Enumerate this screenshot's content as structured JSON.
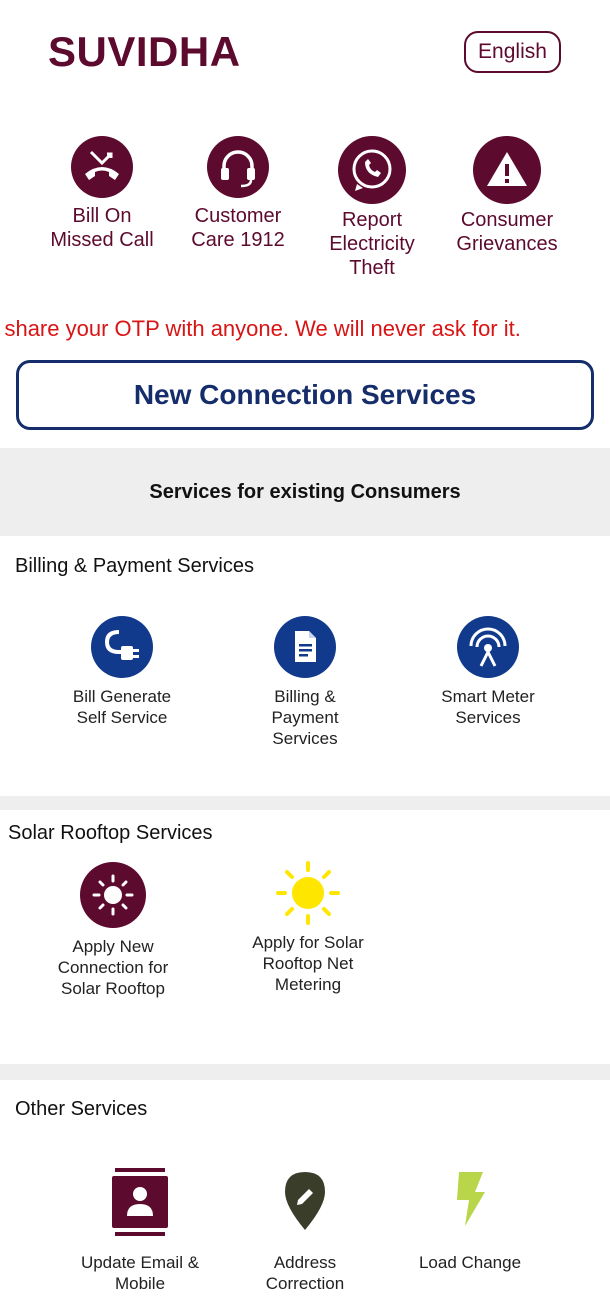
{
  "header": {
    "brand": "SUVIDHA",
    "language": "English"
  },
  "quick_actions": [
    {
      "label": "Bill On\nMissed Call",
      "icon": "phone-missed-icon"
    },
    {
      "label": "Customer\nCare 1912",
      "icon": "headset-icon"
    },
    {
      "label": "Report\nElectricity\nTheft",
      "icon": "whatsapp-icon"
    },
    {
      "label": "Consumer\nGrievances",
      "icon": "warning-icon"
    }
  ],
  "marquee_text": "ot share your OTP with anyone. We will never ask for it.",
  "new_connection_label": "New Connection Services",
  "existing_header": "Services for existing Consumers",
  "billing": {
    "title": "Billing & Payment Services",
    "items": [
      {
        "label": "Bill Generate\nSelf Service",
        "icon": "plug-icon"
      },
      {
        "label": "Billing &\nPayment\nServices",
        "icon": "document-icon"
      },
      {
        "label": "Smart Meter\nServices",
        "icon": "signal-tower-icon"
      }
    ]
  },
  "solar": {
    "title": "Solar Rooftop Services",
    "items": [
      {
        "label": "Apply New\nConnection for\nSolar Rooftop",
        "icon": "sun-gear-icon"
      },
      {
        "label": "Apply for Solar\nRooftop Net\nMetering",
        "icon": "sun-icon"
      }
    ]
  },
  "other": {
    "title": "Other Services",
    "items": [
      {
        "label": "Update Email &\nMobile",
        "icon": "contact-card-icon"
      },
      {
        "label": "Address\nCorrection",
        "icon": "location-pin-icon"
      },
      {
        "label": "Load Change",
        "icon": "lightning-icon"
      }
    ]
  },
  "colors": {
    "brand": "#5c0a2e",
    "navy": "#162d6b",
    "blue_icon": "#123a8c",
    "alert_red": "#d81414",
    "sun_yellow": "#ffe600",
    "bolt_green": "#b9d64a",
    "pin_dark": "#3a3d2a"
  }
}
